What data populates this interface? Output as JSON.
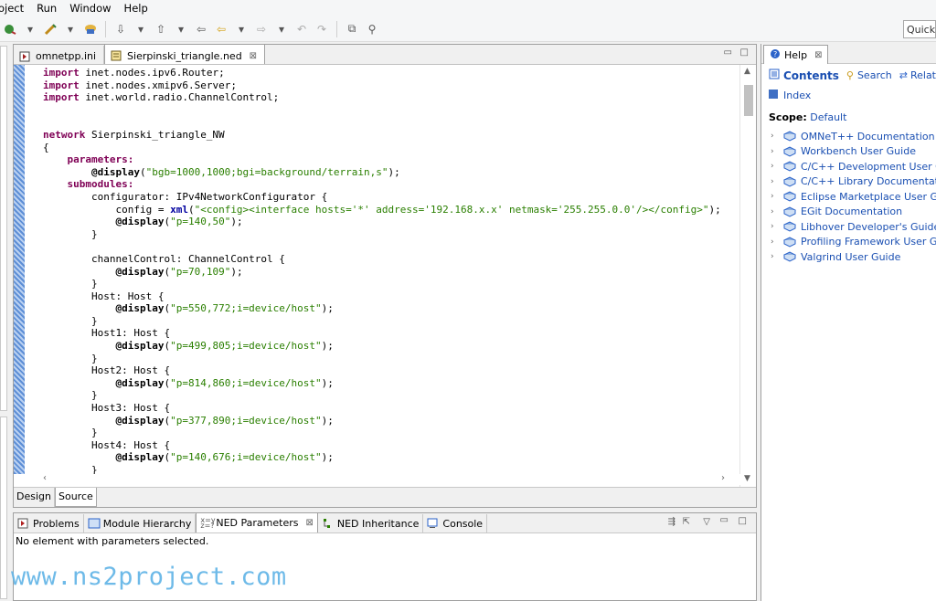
{
  "menu": [
    "oject",
    "Run",
    "Window",
    "Help"
  ],
  "quick_access": "Quick",
  "editor": {
    "tabs": [
      {
        "label": "omnetpp.ini",
        "active": false
      },
      {
        "label": "Sierpinski_triangle.ned",
        "active": true
      }
    ],
    "bottom_tabs": [
      "Design",
      "Source"
    ],
    "active_bottom_tab": "Source",
    "lines": [
      [
        [
          "kw",
          "import"
        ],
        [
          "t",
          " inet.nodes.ipv6.Router;"
        ]
      ],
      [
        [
          "kw",
          "import"
        ],
        [
          "t",
          " inet.nodes.xmipv6.Server;"
        ]
      ],
      [
        [
          "kw",
          "import"
        ],
        [
          "t",
          " inet.world.radio.ChannelControl;"
        ]
      ],
      [
        [
          "t",
          ""
        ]
      ],
      [
        [
          "t",
          ""
        ]
      ],
      [
        [
          "kw",
          "network"
        ],
        [
          "t",
          " Sierpinski_triangle_NW"
        ]
      ],
      [
        [
          "t",
          "{"
        ]
      ],
      [
        [
          "t",
          "    "
        ],
        [
          "kw",
          "parameters:"
        ]
      ],
      [
        [
          "t",
          "        "
        ],
        [
          "anno",
          "@display"
        ],
        [
          "t",
          "("
        ],
        [
          "str",
          "\"bgb=1000,1000;bgi=background/terrain,s\""
        ],
        [
          "t",
          ");"
        ]
      ],
      [
        [
          "t",
          "    "
        ],
        [
          "kw",
          "submodules:"
        ]
      ],
      [
        [
          "t",
          "        configurator: IPv4NetworkConfigurator {"
        ]
      ],
      [
        [
          "t",
          "            config = "
        ],
        [
          "xml",
          "xml"
        ],
        [
          "t",
          "("
        ],
        [
          "str",
          "\"<config><interface hosts='*' address='192.168.x.x' netmask='255.255.0.0'/></config>\""
        ],
        [
          "t",
          ");"
        ]
      ],
      [
        [
          "t",
          "            "
        ],
        [
          "anno",
          "@display"
        ],
        [
          "t",
          "("
        ],
        [
          "str",
          "\"p=140,50\""
        ],
        [
          "t",
          ");"
        ]
      ],
      [
        [
          "t",
          "        }"
        ]
      ],
      [
        [
          "t",
          ""
        ]
      ],
      [
        [
          "t",
          "        channelControl: ChannelControl {"
        ]
      ],
      [
        [
          "t",
          "            "
        ],
        [
          "anno",
          "@display"
        ],
        [
          "t",
          "("
        ],
        [
          "str",
          "\"p=70,109\""
        ],
        [
          "t",
          ");"
        ]
      ],
      [
        [
          "t",
          "        }"
        ]
      ],
      [
        [
          "t",
          "        Host: Host {"
        ]
      ],
      [
        [
          "t",
          "            "
        ],
        [
          "anno",
          "@display"
        ],
        [
          "t",
          "("
        ],
        [
          "str",
          "\"p=550,772;i=device/host\""
        ],
        [
          "t",
          ");"
        ]
      ],
      [
        [
          "t",
          "        }"
        ]
      ],
      [
        [
          "t",
          "        Host1: Host {"
        ]
      ],
      [
        [
          "t",
          "            "
        ],
        [
          "anno",
          "@display"
        ],
        [
          "t",
          "("
        ],
        [
          "str",
          "\"p=499,805;i=device/host\""
        ],
        [
          "t",
          ");"
        ]
      ],
      [
        [
          "t",
          "        }"
        ]
      ],
      [
        [
          "t",
          "        Host2: Host {"
        ]
      ],
      [
        [
          "t",
          "            "
        ],
        [
          "anno",
          "@display"
        ],
        [
          "t",
          "("
        ],
        [
          "str",
          "\"p=814,860;i=device/host\""
        ],
        [
          "t",
          ");"
        ]
      ],
      [
        [
          "t",
          "        }"
        ]
      ],
      [
        [
          "t",
          "        Host3: Host {"
        ]
      ],
      [
        [
          "t",
          "            "
        ],
        [
          "anno",
          "@display"
        ],
        [
          "t",
          "("
        ],
        [
          "str",
          "\"p=377,890;i=device/host\""
        ],
        [
          "t",
          ");"
        ]
      ],
      [
        [
          "t",
          "        }"
        ]
      ],
      [
        [
          "t",
          "        Host4: Host {"
        ]
      ],
      [
        [
          "t",
          "            "
        ],
        [
          "anno",
          "@display"
        ],
        [
          "t",
          "("
        ],
        [
          "str",
          "\"p=140,676;i=device/host\""
        ],
        [
          "t",
          ");"
        ]
      ],
      [
        [
          "t",
          "        }"
        ]
      ]
    ]
  },
  "help": {
    "tab_label": "Help",
    "nav": {
      "contents": "Contents",
      "search": "Search",
      "related": "Related"
    },
    "index": "Index",
    "scope_label": "Scope:",
    "scope_value": "Default",
    "books": [
      "OMNeT++ Documentation",
      "Workbench User Guide",
      "C/C++ Development User Guide",
      "C/C++ Library Documentation",
      "Eclipse Marketplace User Guide",
      "EGit Documentation",
      "Libhover Developer's Guide",
      "Profiling Framework User Guide",
      "Valgrind User Guide"
    ]
  },
  "panel": {
    "tabs": [
      "Problems",
      "Module Hierarchy",
      "NED Parameters",
      "NED Inheritance",
      "Console"
    ],
    "active_tab": "NED Parameters",
    "message": "No element with parameters selected."
  },
  "watermark": "www.ns2project.com",
  "colors": {
    "keyword": "#7f0055",
    "string": "#2a7f00",
    "link": "#1a4fb2",
    "ruler": "#5e8fd6"
  }
}
